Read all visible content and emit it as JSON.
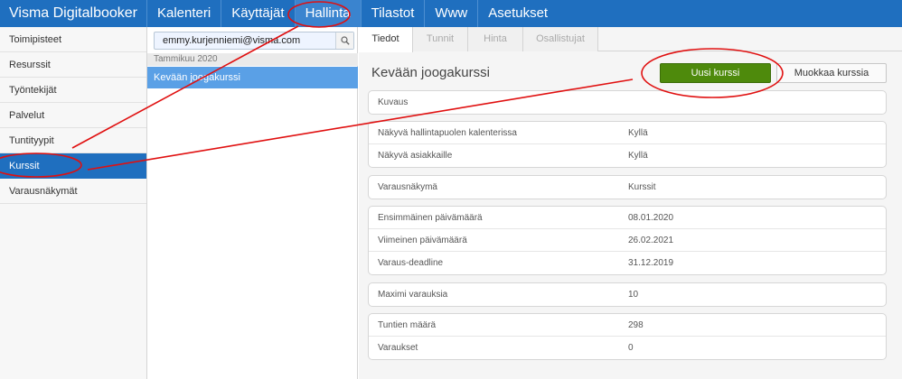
{
  "app": {
    "brand": "Visma Digitalbooker",
    "nav": [
      "Kalenteri",
      "Käyttäjät",
      "Hallinta",
      "Tilastot",
      "Www",
      "Asetukset"
    ]
  },
  "sidebar": {
    "items": [
      "Toimipisteet",
      "Resurssit",
      "Työntekijät",
      "Palvelut",
      "Tuntityypit",
      "Kurssit",
      "Varausnäkymät"
    ]
  },
  "list": {
    "search_value": "emmy.kurjenniemi@visma.com",
    "group_header": "Tammikuu 2020",
    "courses": [
      "Kevään joogakurssi"
    ]
  },
  "tabs": [
    "Tiedot",
    "Tunnit",
    "Hinta",
    "Osallistujat"
  ],
  "detail": {
    "title": "Kevään joogakurssi",
    "new_button": "Uusi kurssi",
    "edit_button": "Muokkaa kurssia",
    "cards": [
      [
        {
          "label": "Kuvaus",
          "value": ""
        }
      ],
      [
        {
          "label": "Näkyvä hallintapuolen kalenterissa",
          "value": "Kyllä"
        },
        {
          "label": "Näkyvä asiakkaille",
          "value": "Kyllä"
        }
      ],
      [
        {
          "label": "Varausnäkymä",
          "value": "Kurssit"
        }
      ],
      [
        {
          "label": "Ensimmäinen päivämäärä",
          "value": "08.01.2020"
        },
        {
          "label": "Viimeinen päivämäärä",
          "value": "26.02.2021"
        },
        {
          "label": "Varaus-deadline",
          "value": "31.12.2019"
        }
      ],
      [
        {
          "label": "Maximi varauksia",
          "value": "10"
        }
      ],
      [
        {
          "label": "Tuntien määrä",
          "value": "298"
        },
        {
          "label": "Varaukset",
          "value": "0"
        }
      ]
    ]
  },
  "colors": {
    "nav_blue": "#1f6fbf",
    "active_item": "#5aa0e6",
    "green_button": "#4e8a0c",
    "annotation_red": "#e01010"
  }
}
